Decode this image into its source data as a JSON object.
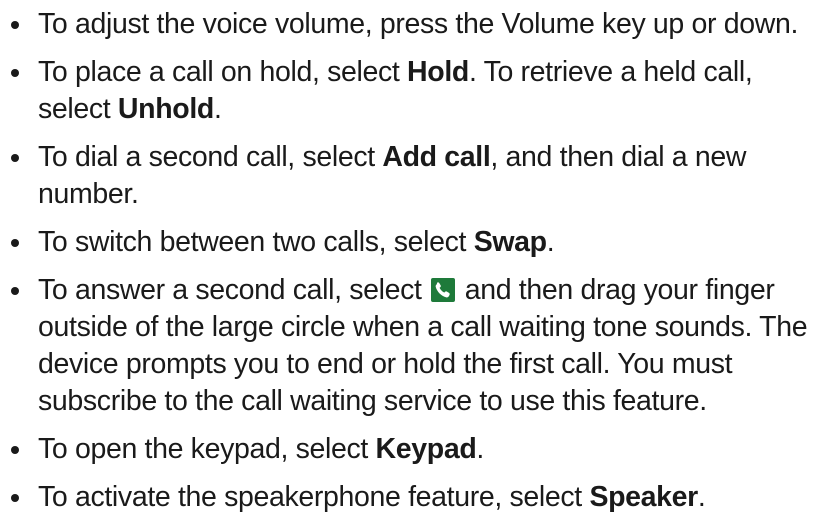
{
  "items": [
    {
      "text": "To adjust the voice volume, press the Volume key up or down."
    },
    {
      "part1": "To place a call on hold, select ",
      "bold1": "Hold",
      "part2": ". To retrieve a held call, select ",
      "bold2": "Unhold",
      "part3": "."
    },
    {
      "part1": "To dial a second call, select ",
      "bold1": "Add call",
      "part2": ", and then dial a new number."
    },
    {
      "part1": "To switch between two calls, select ",
      "bold1": "Swap",
      "part2": "."
    },
    {
      "part1": "To answer a second call, select ",
      "icon": "phone-answer-icon",
      "part2": " and then drag your finger outside of the large circle when a call waiting tone sounds. The device prompts you to end or hold the first call. You must subscribe to the call waiting service to use this feature."
    },
    {
      "part1": "To open the keypad, select ",
      "bold1": "Keypad",
      "part2": "."
    },
    {
      "part1": "To activate the speakerphone feature, select ",
      "bold1": "Speaker",
      "part2": "."
    }
  ],
  "colors": {
    "text": "#1a1a1a",
    "icon_bg": "#1e7a3a",
    "icon_glyph": "#ffffff"
  }
}
